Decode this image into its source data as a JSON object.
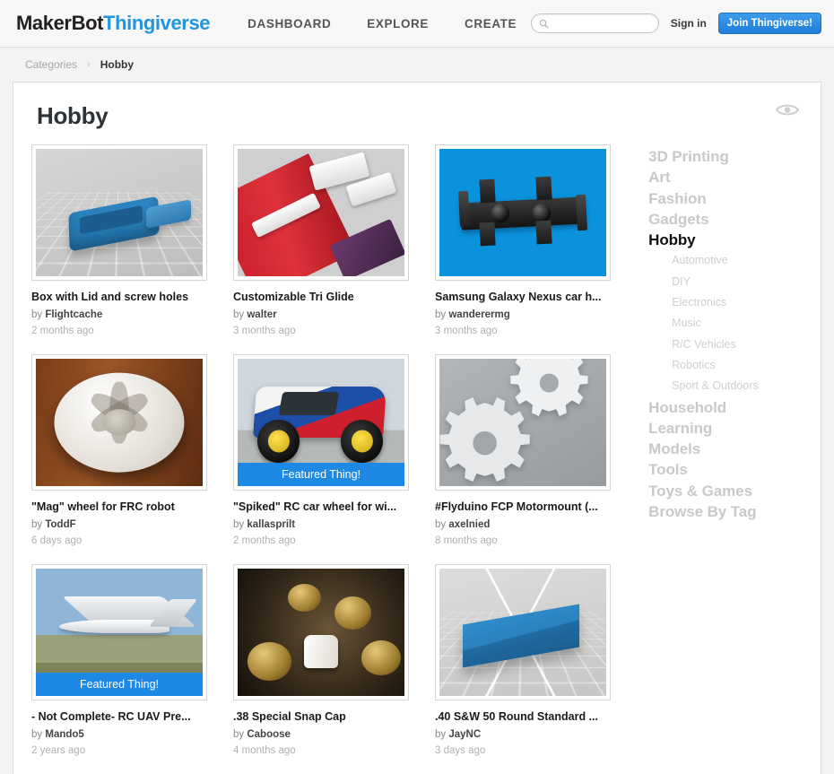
{
  "nav": {
    "logo_makerbot": "MakerBot",
    "logo_thingiverse": "Thingiverse",
    "links": [
      {
        "label": "DASHBOARD"
      },
      {
        "label": "EXPLORE"
      },
      {
        "label": "CREATE"
      }
    ],
    "search_placeholder": "",
    "search_value": "",
    "signin_label": "Sign in",
    "join_label": "Join Thingiverse!"
  },
  "breadcrumb": {
    "parent": "Categories",
    "separator": "›",
    "current": "Hobby"
  },
  "page": {
    "title": "Hobby"
  },
  "things": [
    {
      "title": "Box with Lid and screw holes",
      "by_prefix": "by",
      "author": "Flightcache",
      "date": "2 months ago",
      "art": "blue-box-plate",
      "featured": false,
      "featured_label": ""
    },
    {
      "title": "Customizable Tri Glide",
      "by_prefix": "by",
      "author": "walter",
      "date": "3 months ago",
      "art": "straps-clips",
      "featured": false,
      "featured_label": ""
    },
    {
      "title": "Samsung Galaxy Nexus car h...",
      "by_prefix": "by",
      "author": "wanderermg",
      "date": "3 months ago",
      "art": "black-mount-cyan",
      "featured": false,
      "featured_label": ""
    },
    {
      "title": "\"Mag\" wheel for FRC robot",
      "by_prefix": "by",
      "author": "ToddF",
      "date": "6 days ago",
      "art": "white-wheel-wood",
      "featured": false,
      "featured_label": ""
    },
    {
      "title": "\"Spiked\" RC car wheel for wi...",
      "by_prefix": "by",
      "author": "kallasprilt",
      "date": "2 months ago",
      "art": "rc-truck",
      "featured": true,
      "featured_label": "Featured Thing!"
    },
    {
      "title": "#Flyduino FCP Motormount (...",
      "by_prefix": "by",
      "author": "axelnied",
      "date": "8 months ago",
      "art": "gears-placeholder",
      "featured": false,
      "featured_label": ""
    },
    {
      "title": "- Not Complete- RC UAV Pre...",
      "by_prefix": "by",
      "author": "Mando5",
      "date": "2 years ago",
      "art": "uav-sky",
      "featured": true,
      "featured_label": "Featured Thing!"
    },
    {
      "title": ".38 Special Snap Cap",
      "by_prefix": "by",
      "author": "Caboose",
      "date": "4 months ago",
      "art": "brass-casings",
      "featured": false,
      "featured_label": ""
    },
    {
      "title": ".40 S&W 50 Round Standard ...",
      "by_prefix": "by",
      "author": "JayNC",
      "date": "3 days ago",
      "art": "blue-slab-plate",
      "featured": false,
      "featured_label": ""
    }
  ],
  "sidebar": {
    "categories": [
      {
        "label": "3D Printing",
        "active": false
      },
      {
        "label": "Art",
        "active": false
      },
      {
        "label": "Fashion",
        "active": false
      },
      {
        "label": "Gadgets",
        "active": false
      },
      {
        "label": "Hobby",
        "active": true
      }
    ],
    "subcategories": [
      {
        "label": "Automotive"
      },
      {
        "label": "DIY"
      },
      {
        "label": "Electronics"
      },
      {
        "label": "Music"
      },
      {
        "label": "R/C Vehicles"
      },
      {
        "label": "Robotics"
      },
      {
        "label": "Sport & Outdoors"
      }
    ],
    "categories_after": [
      {
        "label": "Household",
        "active": false
      },
      {
        "label": "Learning",
        "active": false
      },
      {
        "label": "Models",
        "active": false
      },
      {
        "label": "Tools",
        "active": false
      },
      {
        "label": "Toys & Games",
        "active": false
      },
      {
        "label": "Browse By Tag",
        "active": false
      }
    ]
  },
  "colors": {
    "brand_blue": "#2195e0",
    "button_blue": "#1f7fd6",
    "featured_blue": "#1e88e5",
    "text_dark": "#1a1a1a",
    "muted": "#a6a6a6"
  }
}
